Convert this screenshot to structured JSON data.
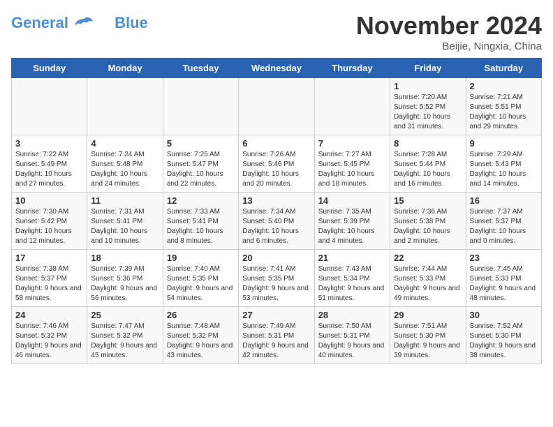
{
  "logo": {
    "line1": "General",
    "line2": "Blue"
  },
  "title": "November 2024",
  "location": "Beijie, Ningxia, China",
  "days_of_week": [
    "Sunday",
    "Monday",
    "Tuesday",
    "Wednesday",
    "Thursday",
    "Friday",
    "Saturday"
  ],
  "weeks": [
    [
      {
        "day": "",
        "info": ""
      },
      {
        "day": "",
        "info": ""
      },
      {
        "day": "",
        "info": ""
      },
      {
        "day": "",
        "info": ""
      },
      {
        "day": "",
        "info": ""
      },
      {
        "day": "1",
        "info": "Sunrise: 7:20 AM\nSunset: 5:52 PM\nDaylight: 10 hours and 31 minutes."
      },
      {
        "day": "2",
        "info": "Sunrise: 7:21 AM\nSunset: 5:51 PM\nDaylight: 10 hours and 29 minutes."
      }
    ],
    [
      {
        "day": "3",
        "info": "Sunrise: 7:22 AM\nSunset: 5:49 PM\nDaylight: 10 hours and 27 minutes."
      },
      {
        "day": "4",
        "info": "Sunrise: 7:24 AM\nSunset: 5:48 PM\nDaylight: 10 hours and 24 minutes."
      },
      {
        "day": "5",
        "info": "Sunrise: 7:25 AM\nSunset: 5:47 PM\nDaylight: 10 hours and 22 minutes."
      },
      {
        "day": "6",
        "info": "Sunrise: 7:26 AM\nSunset: 5:46 PM\nDaylight: 10 hours and 20 minutes."
      },
      {
        "day": "7",
        "info": "Sunrise: 7:27 AM\nSunset: 5:45 PM\nDaylight: 10 hours and 18 minutes."
      },
      {
        "day": "8",
        "info": "Sunrise: 7:28 AM\nSunset: 5:44 PM\nDaylight: 10 hours and 16 minutes."
      },
      {
        "day": "9",
        "info": "Sunrise: 7:29 AM\nSunset: 5:43 PM\nDaylight: 10 hours and 14 minutes."
      }
    ],
    [
      {
        "day": "10",
        "info": "Sunrise: 7:30 AM\nSunset: 5:42 PM\nDaylight: 10 hours and 12 minutes."
      },
      {
        "day": "11",
        "info": "Sunrise: 7:31 AM\nSunset: 5:41 PM\nDaylight: 10 hours and 10 minutes."
      },
      {
        "day": "12",
        "info": "Sunrise: 7:33 AM\nSunset: 5:41 PM\nDaylight: 10 hours and 8 minutes."
      },
      {
        "day": "13",
        "info": "Sunrise: 7:34 AM\nSunset: 5:40 PM\nDaylight: 10 hours and 6 minutes."
      },
      {
        "day": "14",
        "info": "Sunrise: 7:35 AM\nSunset: 5:39 PM\nDaylight: 10 hours and 4 minutes."
      },
      {
        "day": "15",
        "info": "Sunrise: 7:36 AM\nSunset: 5:38 PM\nDaylight: 10 hours and 2 minutes."
      },
      {
        "day": "16",
        "info": "Sunrise: 7:37 AM\nSunset: 5:37 PM\nDaylight: 10 hours and 0 minutes."
      }
    ],
    [
      {
        "day": "17",
        "info": "Sunrise: 7:38 AM\nSunset: 5:37 PM\nDaylight: 9 hours and 58 minutes."
      },
      {
        "day": "18",
        "info": "Sunrise: 7:39 AM\nSunset: 5:36 PM\nDaylight: 9 hours and 56 minutes."
      },
      {
        "day": "19",
        "info": "Sunrise: 7:40 AM\nSunset: 5:35 PM\nDaylight: 9 hours and 54 minutes."
      },
      {
        "day": "20",
        "info": "Sunrise: 7:41 AM\nSunset: 5:35 PM\nDaylight: 9 hours and 53 minutes."
      },
      {
        "day": "21",
        "info": "Sunrise: 7:43 AM\nSunset: 5:34 PM\nDaylight: 9 hours and 51 minutes."
      },
      {
        "day": "22",
        "info": "Sunrise: 7:44 AM\nSunset: 5:33 PM\nDaylight: 9 hours and 49 minutes."
      },
      {
        "day": "23",
        "info": "Sunrise: 7:45 AM\nSunset: 5:33 PM\nDaylight: 9 hours and 48 minutes."
      }
    ],
    [
      {
        "day": "24",
        "info": "Sunrise: 7:46 AM\nSunset: 5:32 PM\nDaylight: 9 hours and 46 minutes."
      },
      {
        "day": "25",
        "info": "Sunrise: 7:47 AM\nSunset: 5:32 PM\nDaylight: 9 hours and 45 minutes."
      },
      {
        "day": "26",
        "info": "Sunrise: 7:48 AM\nSunset: 5:32 PM\nDaylight: 9 hours and 43 minutes."
      },
      {
        "day": "27",
        "info": "Sunrise: 7:49 AM\nSunset: 5:31 PM\nDaylight: 9 hours and 42 minutes."
      },
      {
        "day": "28",
        "info": "Sunrise: 7:50 AM\nSunset: 5:31 PM\nDaylight: 9 hours and 40 minutes."
      },
      {
        "day": "29",
        "info": "Sunrise: 7:51 AM\nSunset: 5:30 PM\nDaylight: 9 hours and 39 minutes."
      },
      {
        "day": "30",
        "info": "Sunrise: 7:52 AM\nSunset: 5:30 PM\nDaylight: 9 hours and 38 minutes."
      }
    ]
  ]
}
